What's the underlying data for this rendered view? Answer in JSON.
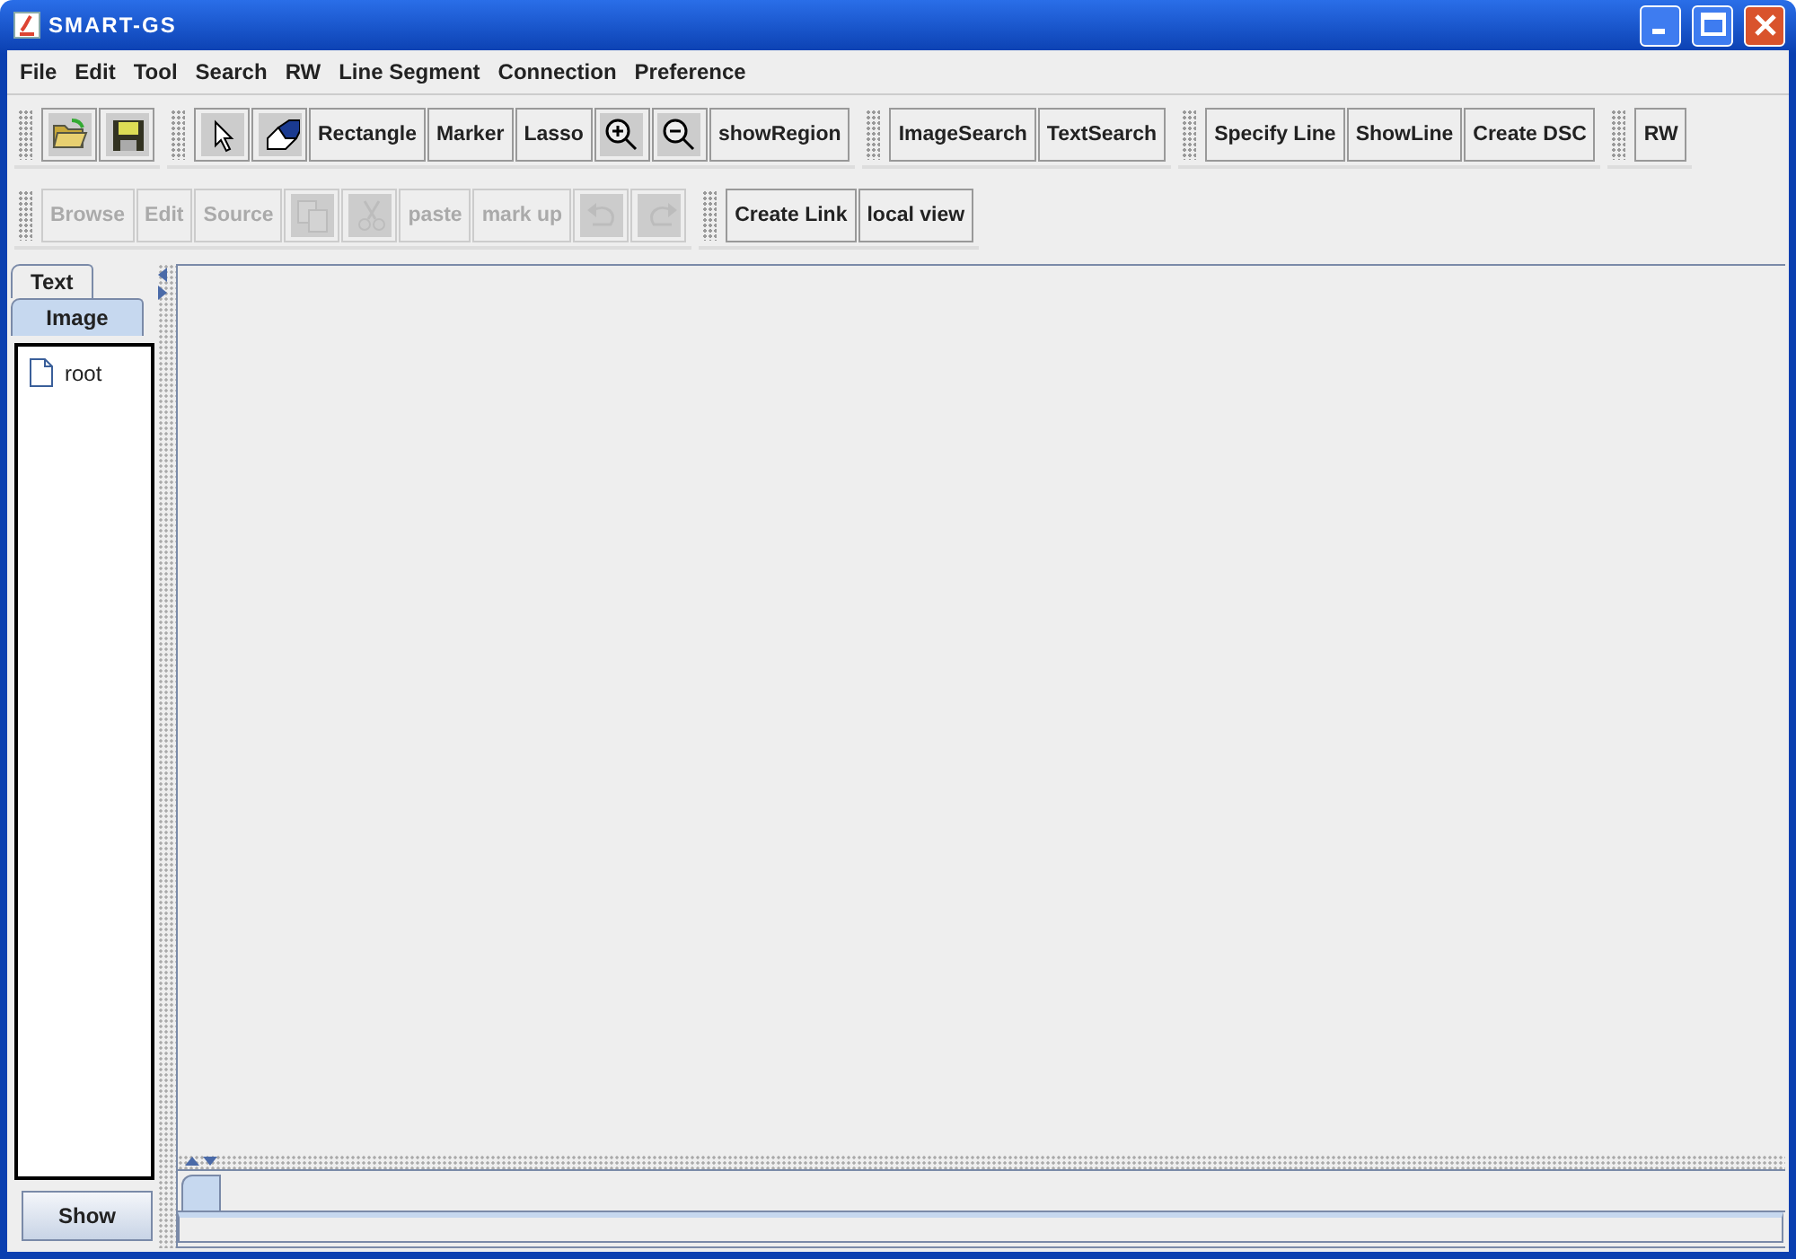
{
  "window": {
    "title": "SMART-GS"
  },
  "menu": [
    "File",
    "Edit",
    "Tool",
    "Search",
    "RW",
    "Line Segment",
    "Connection",
    "Preference"
  ],
  "toolbar_rows": [
    [
      {
        "buttons": [
          {
            "kind": "icon",
            "disabled": false
          },
          {
            "kind": "icon",
            "disabled": false
          }
        ]
      },
      {
        "buttons": [
          {
            "kind": "icon",
            "disabled": false
          },
          {
            "kind": "icon",
            "disabled": false
          },
          {
            "kind": "text",
            "label": "Rectangle",
            "disabled": false
          },
          {
            "kind": "text",
            "label": "Marker",
            "disabled": false
          },
          {
            "kind": "text",
            "label": "Lasso",
            "disabled": false
          },
          {
            "kind": "icon",
            "disabled": false
          },
          {
            "kind": "icon",
            "disabled": false
          },
          {
            "kind": "text",
            "label": "showRegion",
            "disabled": false
          }
        ]
      },
      {
        "buttons": [
          {
            "kind": "text",
            "label": "ImageSearch",
            "disabled": false
          },
          {
            "kind": "text",
            "label": "TextSearch",
            "disabled": false
          }
        ]
      },
      {
        "buttons": [
          {
            "kind": "text",
            "label": "Specify Line",
            "disabled": false
          },
          {
            "kind": "text",
            "label": "ShowLine",
            "disabled": false
          },
          {
            "kind": "text",
            "label": "Create DSC",
            "disabled": false
          }
        ]
      },
      {
        "buttons": [
          {
            "kind": "text",
            "label": "RW",
            "disabled": false
          }
        ]
      }
    ],
    [
      {
        "buttons": [
          {
            "kind": "text",
            "label": "Browse",
            "disabled": true
          },
          {
            "kind": "text",
            "label": "Edit",
            "disabled": true
          },
          {
            "kind": "text",
            "label": "Source",
            "disabled": true
          },
          {
            "kind": "icon",
            "disabled": true
          },
          {
            "kind": "icon",
            "disabled": true
          },
          {
            "kind": "text",
            "label": "paste",
            "disabled": true
          },
          {
            "kind": "text",
            "label": "mark up",
            "disabled": true
          },
          {
            "kind": "icon",
            "disabled": true
          },
          {
            "kind": "icon",
            "disabled": true
          }
        ]
      },
      {
        "buttons": [
          {
            "kind": "text",
            "label": "Create Link",
            "disabled": false
          },
          {
            "kind": "text",
            "label": "local view",
            "disabled": false
          }
        ]
      }
    ]
  ],
  "side_tabs": [
    {
      "label": "Text",
      "selected": false
    },
    {
      "label": "Image",
      "selected": true
    }
  ],
  "tree": [
    {
      "label": "root"
    }
  ],
  "show_button": "Show"
}
